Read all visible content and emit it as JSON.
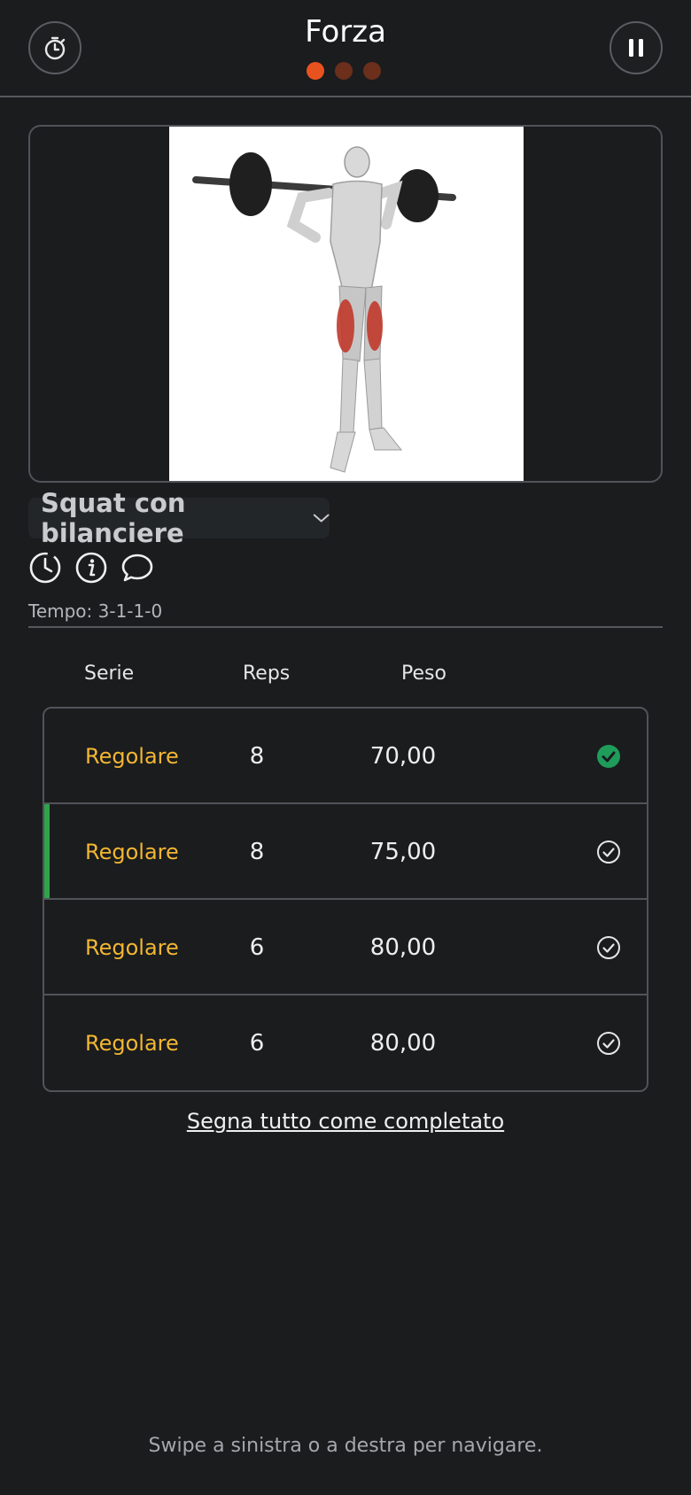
{
  "header": {
    "title": "Forza",
    "left_icon": "stopwatch-icon",
    "right_icon": "pause-icon",
    "pager": {
      "total": 3,
      "active_index": 0
    }
  },
  "exercise": {
    "name": "Squat con bilanciere",
    "tempo": "Tempo: 3-1-1-0"
  },
  "table": {
    "headers": {
      "series": "Serie",
      "reps": "Reps",
      "weight": "Peso"
    },
    "rows": [
      {
        "type": "Regolare",
        "reps": "8",
        "weight": "70,00",
        "completed": true,
        "active": false
      },
      {
        "type": "Regolare",
        "reps": "8",
        "weight": "75,00",
        "completed": false,
        "active": true
      },
      {
        "type": "Regolare",
        "reps": "6",
        "weight": "80,00",
        "completed": false,
        "active": false
      },
      {
        "type": "Regolare",
        "reps": "6",
        "weight": "80,00",
        "completed": false,
        "active": false
      }
    ]
  },
  "mark_all_label": "Segna tutto come completato",
  "swipe_hint": "Swipe a sinistra o a destra per navigare.",
  "colors": {
    "accent_orange": "#e8521f",
    "set_type_yellow": "#f2b632",
    "complete_green": "#1f9c5a",
    "active_bar_green": "#2fa34a",
    "background": "#1a1c1e"
  }
}
